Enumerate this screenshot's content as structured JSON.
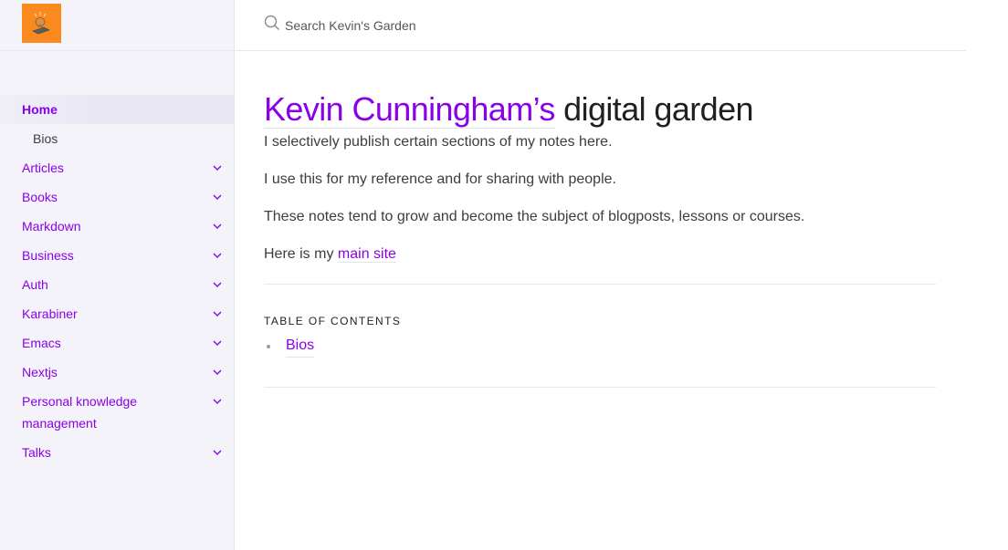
{
  "search": {
    "placeholder": "Search Kevin's Garden"
  },
  "sidebar": {
    "items": [
      {
        "label": "Home",
        "active": true,
        "expandable": false
      },
      {
        "label": "Bios",
        "sub": true,
        "expandable": false
      },
      {
        "label": "Articles",
        "expandable": true
      },
      {
        "label": "Books",
        "expandable": true
      },
      {
        "label": "Markdown",
        "expandable": true
      },
      {
        "label": "Business",
        "expandable": true
      },
      {
        "label": "Auth",
        "expandable": true
      },
      {
        "label": "Karabiner",
        "expandable": true
      },
      {
        "label": "Emacs",
        "expandable": true
      },
      {
        "label": "Nextjs",
        "expandable": true
      },
      {
        "label": "Personal knowledge management",
        "expandable": true
      },
      {
        "label": "Talks",
        "expandable": true
      }
    ]
  },
  "main": {
    "title_link": "Kevin Cunningham’s",
    "title_rest": " digital garden",
    "paragraphs": [
      "I selectively publish certain sections of my notes here.",
      "I use this for my reference and for sharing with people.",
      "These notes tend to grow and become the subject of blogposts, lessons or courses."
    ],
    "main_site_prefix": "Here is my ",
    "main_site_link": "main site",
    "toc_title": "TABLE OF CONTENTS",
    "toc_items": [
      "Bios"
    ]
  },
  "colors": {
    "accent": "#8a00e8",
    "logo_bg": "#fb8a1e",
    "sidebar_bg": "#f4f3fa"
  }
}
